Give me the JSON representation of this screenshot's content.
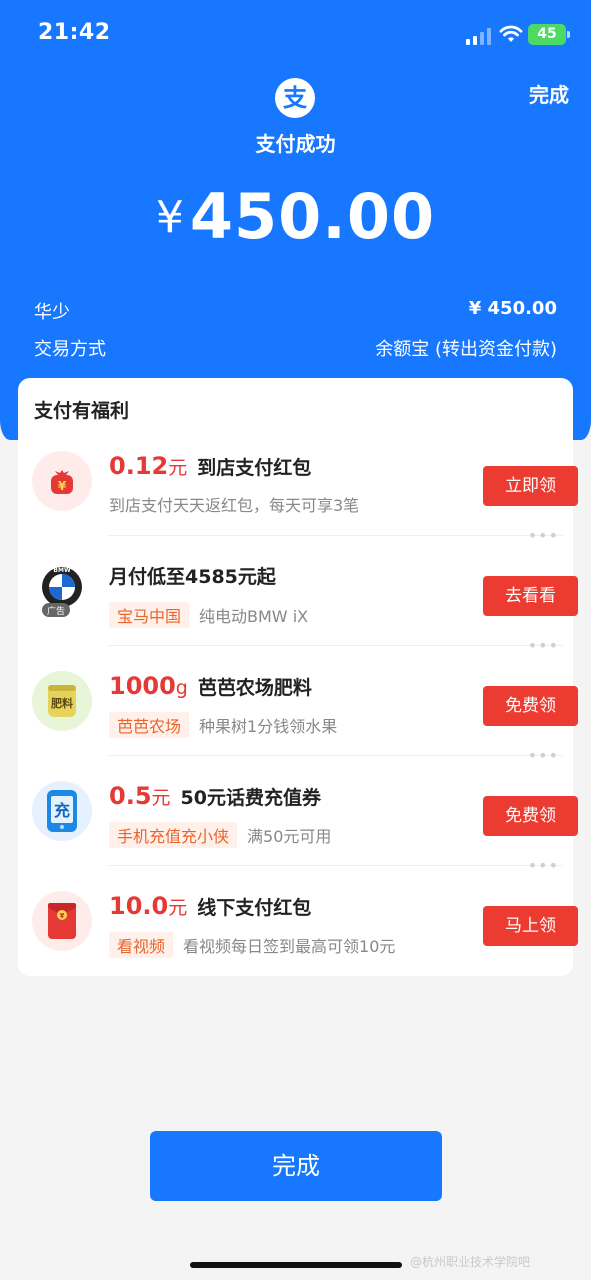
{
  "status_bar": {
    "time": "21:42",
    "battery": "45"
  },
  "header": {
    "done_label": "完成",
    "logo_char": "支",
    "title": "支付成功",
    "currency": "¥",
    "amount": "450.00"
  },
  "details": [
    {
      "label": "华少",
      "value": "¥ 450.00"
    },
    {
      "label": "交易方式",
      "value": "余额宝 (转出资金付款)"
    }
  ],
  "benefits": {
    "title": "支付有福利",
    "items": [
      {
        "num": "0.12",
        "unit": "元",
        "headline": "到店支付红包",
        "tag": "",
        "desc": "到店支付天天返红包，每天可享3笔",
        "button": "立即领",
        "icon": "money-bag-icon"
      },
      {
        "num": "",
        "unit": "",
        "headline": "月付低至4585元起",
        "tag": "宝马中国",
        "desc": "纯电动BMW iX",
        "button": "去看看",
        "icon": "bmw-logo-icon",
        "icon_text": "BMW",
        "ad_label": "广告"
      },
      {
        "num": "1000",
        "unit": "g",
        "headline": "芭芭农场肥料",
        "tag": "芭芭农场",
        "desc": "种果树1分钱领水果",
        "button": "免费领",
        "icon": "fertilizer-bag-icon",
        "icon_text": "肥料"
      },
      {
        "num": "0.5",
        "unit": "元",
        "headline": "50元话费充值券",
        "tag": "手机充值充小侠",
        "desc": "满50元可用",
        "button": "免费领",
        "icon": "phone-recharge-icon",
        "icon_text": "充"
      },
      {
        "num": "10.0",
        "unit": "元",
        "headline": "线下支付红包",
        "tag": "看视频",
        "desc": "看视频每日签到最高可领10元",
        "button": "马上领",
        "icon": "red-envelope-icon"
      }
    ]
  },
  "footer": {
    "done_label": "完成",
    "watermark": "@杭州职业技术学院吧"
  },
  "colors": {
    "primary": "#1777ff",
    "red": "#ec3b31",
    "tag_bg": "#fff1ea",
    "tag_text": "#e8652f"
  }
}
